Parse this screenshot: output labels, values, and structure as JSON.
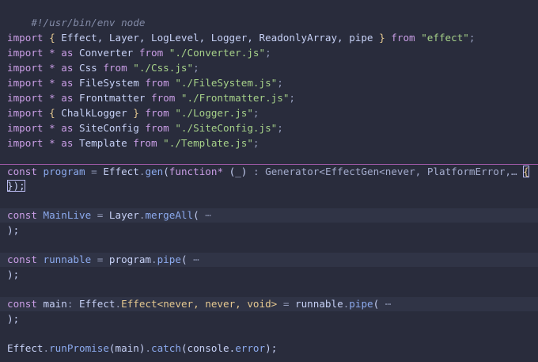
{
  "editor": {
    "lines": [
      {
        "t": "#!/usr/bin/env node"
      },
      {
        "t": ""
      },
      {
        "a": "import",
        "b": " { ",
        "c": "Effect, Layer, LogLevel, Logger, ReadonlyArray, pipe",
        "d": " } ",
        "e": "from",
        "f": " \"effect\"",
        "g": ";"
      },
      {
        "a": "import",
        "b": " * ",
        "c": "as",
        "d": " Converter ",
        "e": "from",
        "f": " \"./Converter.js\"",
        "g": ";"
      },
      {
        "a": "import",
        "b": " * ",
        "c": "as",
        "d": " Css ",
        "e": "from",
        "f": " \"./Css.js\"",
        "g": ";"
      },
      {
        "a": "import",
        "b": " * ",
        "c": "as",
        "d": " FileSystem ",
        "e": "from",
        "f": " \"./FileSystem.js\"",
        "g": ";"
      },
      {
        "a": "import",
        "b": " * ",
        "c": "as",
        "d": " Frontmatter ",
        "e": "from",
        "f": " \"./Frontmatter.js\"",
        "g": ";"
      },
      {
        "a": "import",
        "b": " { ",
        "c": "ChalkLogger",
        "d": " } ",
        "e": "from",
        "f": " \"./Logger.js\"",
        "g": ";"
      },
      {
        "a": "import",
        "b": " * ",
        "c": "as",
        "d": " SiteConfig ",
        "e": "from",
        "f": " \"./SiteConfig.js\"",
        "g": ";"
      },
      {
        "a": "import",
        "b": " * ",
        "c": "as",
        "d": " Template ",
        "e": "from",
        "f": " \"./Template.js\"",
        "g": ";"
      }
    ],
    "program": {
      "const_kw": "const",
      "name": " program",
      "eq": " = ",
      "obj": "Effect",
      "dot": ".",
      "method": "gen",
      "open": "(",
      "fkw": "function*",
      "args": " (_)",
      "hint": " : Generator<EffectGen<never, PlatformError,… ",
      "brace": "{",
      "close_line": "});"
    },
    "mainlive": {
      "const_kw": "const",
      "name": " MainLive",
      "eq": " = ",
      "obj": "Layer",
      "dot": ".",
      "method": "mergeAll",
      "open": "(",
      "fold": " ⋯",
      "close": ");"
    },
    "runnable": {
      "const_kw": "const",
      "name": " runnable",
      "eq": " = ",
      "obj": "program",
      "dot": ".",
      "method": "pipe",
      "open": "(",
      "fold": " ⋯",
      "close": ");"
    },
    "main": {
      "const_kw": "const",
      "name": " main",
      "colon": ": ",
      "type1": "Effect",
      "dot1": ".",
      "type2": "Effect",
      "generics": "<never, never, void>",
      "eq": " = ",
      "obj": "runnable",
      "dot": ".",
      "method": "pipe",
      "open": "(",
      "fold": " ⋯",
      "close": ");"
    },
    "run": {
      "obj": "Effect",
      "dot": ".",
      "method": "runPromise",
      "args": "(main)",
      "dot2": ".",
      "method2": "catch",
      "args2_open": "(console.",
      "prop": "error",
      "args2_close": ");"
    }
  }
}
